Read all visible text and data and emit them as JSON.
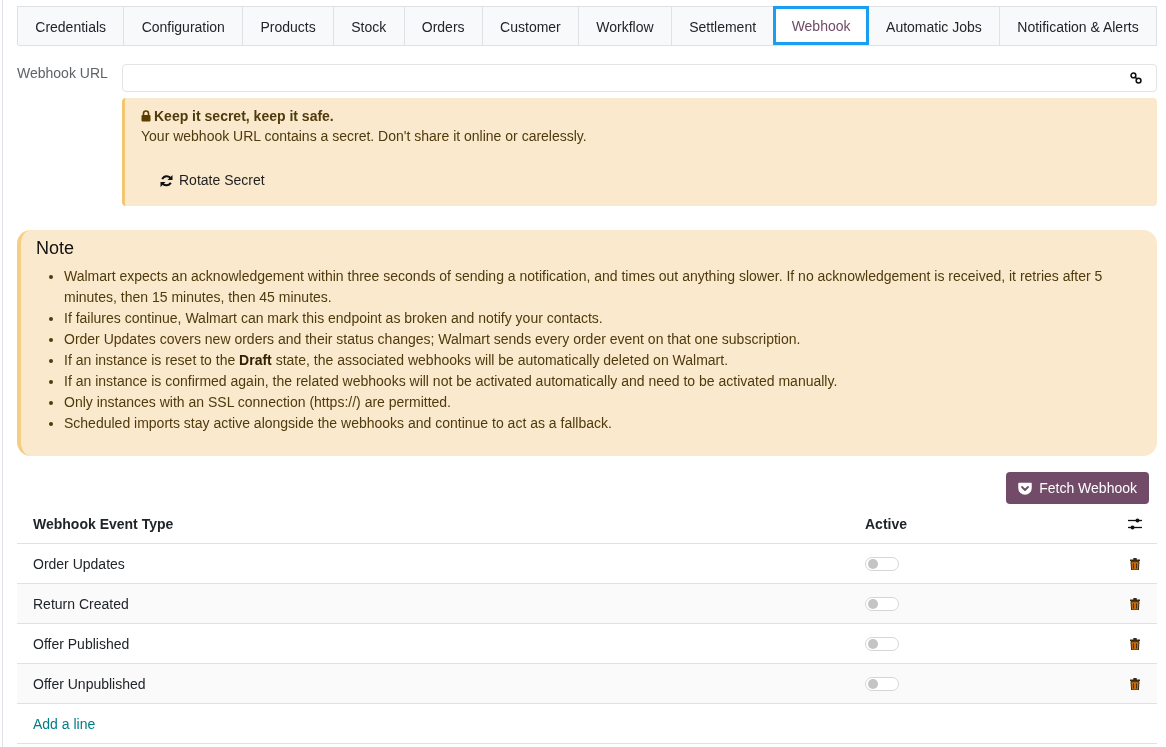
{
  "tabs": [
    {
      "label": "Credentials",
      "selected": false
    },
    {
      "label": "Configuration",
      "selected": false
    },
    {
      "label": "Products",
      "selected": false
    },
    {
      "label": "Stock",
      "selected": false
    },
    {
      "label": "Orders",
      "selected": false
    },
    {
      "label": "Customer",
      "selected": false
    },
    {
      "label": "Workflow",
      "selected": false
    },
    {
      "label": "Settlement",
      "selected": false
    },
    {
      "label": "Webhook",
      "selected": true
    },
    {
      "label": "Automatic Jobs",
      "selected": false
    },
    {
      "label": "Notification & Alerts",
      "selected": false
    }
  ],
  "webhook_url": {
    "label": "Webhook URL"
  },
  "secret_alert": {
    "title": "Keep it secret, keep it safe.",
    "text": "Your webhook URL contains a secret. Don't share it online or carelessly.",
    "button": "Rotate Secret"
  },
  "note": {
    "title": "Note",
    "items": [
      "Walmart expects an acknowledgement within three seconds of sending a notification, and times out anything slower. If no acknowledgement is received, it retries after 5 minutes, then 15 minutes, then 45 minutes.",
      "If failures continue, Walmart can mark this endpoint as broken and notify your contacts.",
      "Order Updates covers new orders and their status changes; Walmart sends every order event on that one subscription.",
      "If an instance is reset to the **Draft** state, the associated webhooks will be automatically deleted on Walmart.",
      "If an instance is confirmed again, the related webhooks will not be activated automatically and need to be activated manually.",
      "Only instances with an SSL connection (https://) are permitted.",
      "Scheduled imports stay active alongside the webhooks and continue to act as a fallback."
    ]
  },
  "fetch_button": "Fetch Webhook",
  "table": {
    "columns": [
      "Webhook Event Type",
      "Active"
    ],
    "rows": [
      {
        "event": "Order Updates",
        "active": false
      },
      {
        "event": "Return Created",
        "active": false
      },
      {
        "event": "Offer Published",
        "active": false
      },
      {
        "event": "Offer Unpublished",
        "active": false
      }
    ],
    "add_line": "Add a line"
  }
}
